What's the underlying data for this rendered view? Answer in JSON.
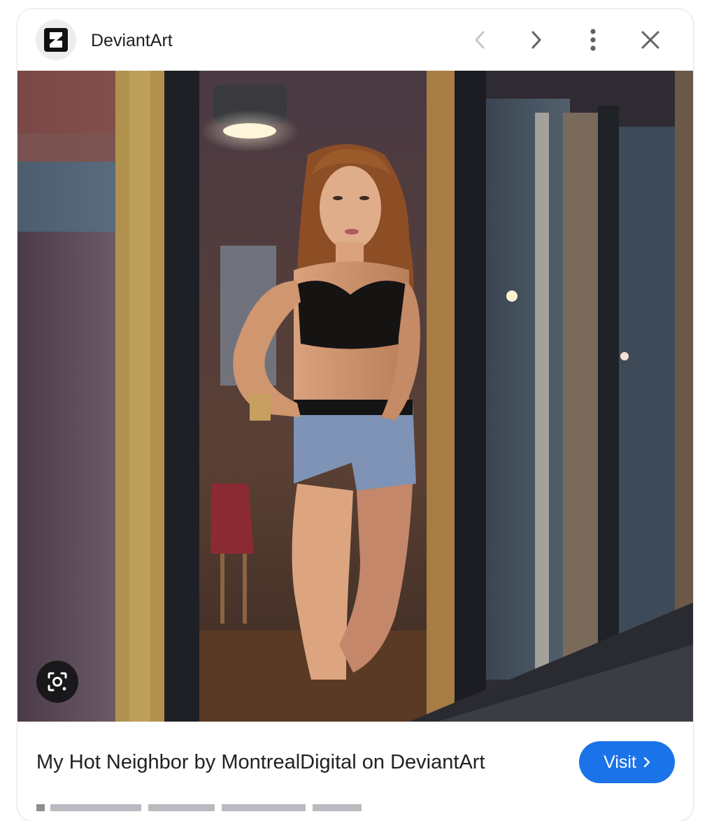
{
  "header": {
    "site_name": "DeviantArt",
    "icons": {
      "site": "deviantart-logo-icon",
      "prev": "chevron-left-icon",
      "next": "chevron-right-icon",
      "more": "more-vert-icon",
      "close": "close-icon"
    }
  },
  "image": {
    "subject": "person-photo",
    "lens_icon": "lens-search-icon"
  },
  "footer": {
    "title": "My Hot Neighbor by MontrealDigital on DeviantArt",
    "visit_label": "Visit",
    "visit_icon": "chevron-right-icon"
  },
  "colors": {
    "accent": "#1a73e8",
    "text": "#202124",
    "disabled_icon": "#c4c7cc",
    "icon": "#5f6368"
  }
}
